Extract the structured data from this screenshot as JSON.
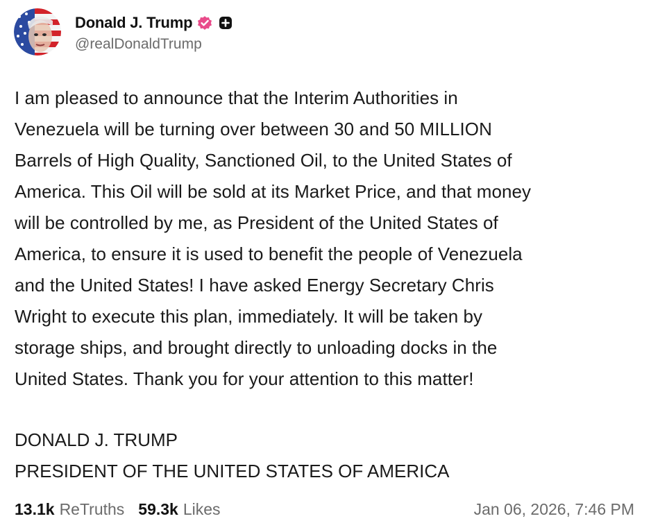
{
  "author": {
    "display_name": "Donald J. Trump",
    "handle": "@realDonaldTrump",
    "verified_color": "#e94b8a"
  },
  "post": {
    "body": "I am pleased to announce that the Interim Authorities in\nVenezuela will be turning over between 30 and 50 MILLION\nBarrels of High Quality, Sanctioned Oil, to the United States of\nAmerica. This Oil will be sold at its Market Price, and that money\nwill be controlled by me, as President of the United States of\nAmerica, to ensure it is used to benefit the people of Venezuela\nand the United States! I have asked Energy Secretary Chris\nWright to execute this plan, immediately. It will be taken by\nstorage ships, and brought directly to unloading docks in the\nUnited States. Thank you for your attention to this matter!",
    "signature_line1": "DONALD J. TRUMP",
    "signature_line2": "PRESIDENT OF THE UNITED STATES OF AMERICA"
  },
  "stats": {
    "retruths_count": "13.1k",
    "retruths_label": "ReTruths",
    "likes_count": "59.3k",
    "likes_label": "Likes"
  },
  "timestamp": "Jan 06, 2026, 7:46 PM",
  "icons": {
    "avatar": "portrait-avatar",
    "verified": "verified-badge-icon",
    "plus": "plus-square-icon"
  }
}
